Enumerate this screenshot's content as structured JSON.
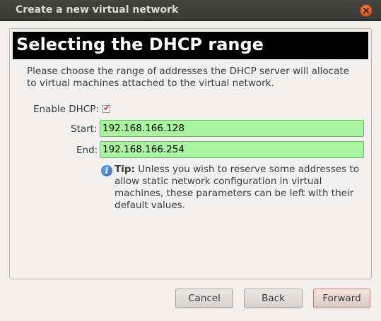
{
  "window": {
    "title": "Create a new virtual network"
  },
  "page": {
    "heading": "Selecting the DHCP range",
    "description": "Please choose the range of addresses the DHCP server will allocate to virtual machines attached to the virtual network."
  },
  "form": {
    "enable_dhcp_label": "Enable DHCP:",
    "enable_dhcp_checked": true,
    "start_label": "Start:",
    "start_value": "192.168.166.128",
    "end_label": "End:",
    "end_value": "192.168.166.254"
  },
  "tip": {
    "label": "Tip:",
    "text": " Unless you wish to reserve some addresses to allow static network configuration in virtual machines, these parameters can be left with their default values."
  },
  "buttons": {
    "cancel": "Cancel",
    "back": "Back",
    "forward": "Forward"
  },
  "colors": {
    "valid_field_bg": "#aaf5a0",
    "titlebar": "#3c3b37",
    "close_button": "#e8602c"
  }
}
